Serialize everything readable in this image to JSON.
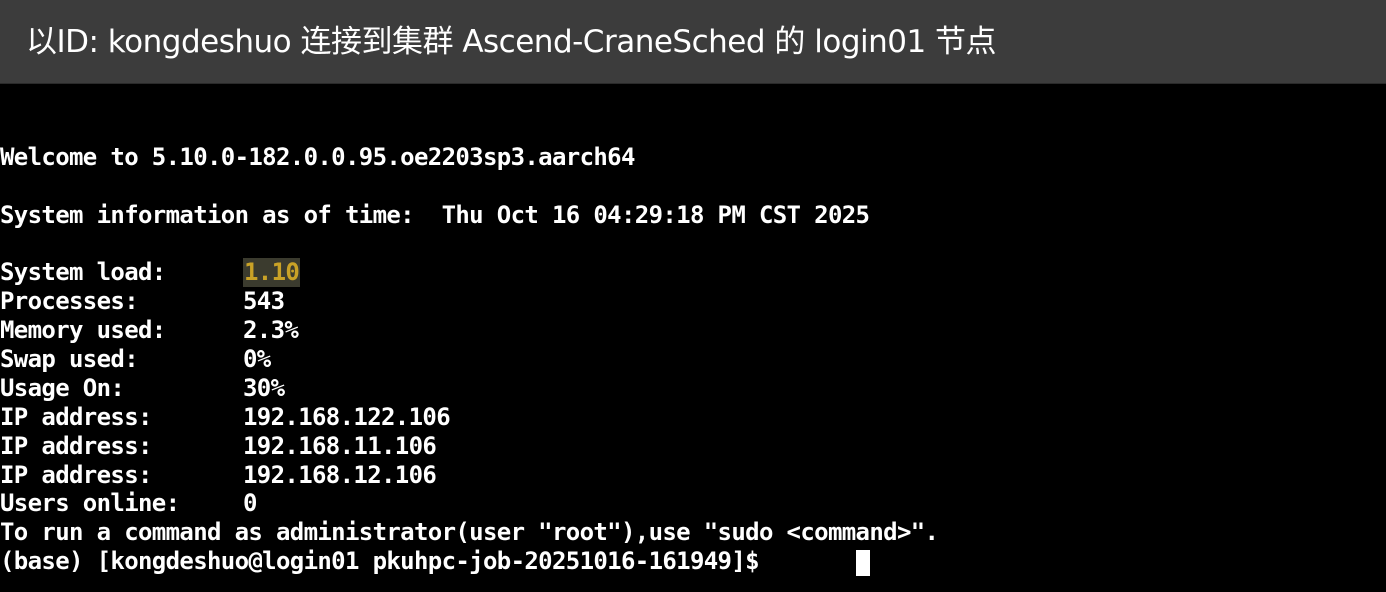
{
  "window": {
    "title": "以ID: kongdeshuo 连接到集群 Ascend-CraneSched 的 login01 节点"
  },
  "terminal": {
    "welcome": "Welcome to 5.10.0-182.0.0.95.oe2203sp3.aarch64",
    "sysinfo": "System information as of time:  Thu Oct 16 04:29:18 PM CST 2025",
    "stats": [
      {
        "label": "System load:",
        "value": "1.10"
      },
      {
        "label": "Processes:",
        "value": "543"
      },
      {
        "label": "Memory used:",
        "value": "2.3%"
      },
      {
        "label": "Swap used:",
        "value": "0%"
      },
      {
        "label": "Usage On:",
        "value": "30%"
      },
      {
        "label": "IP address:",
        "value": "192.168.122.106"
      },
      {
        "label": "IP address:",
        "value": "192.168.11.106"
      },
      {
        "label": "IP address:",
        "value": "192.168.12.106"
      },
      {
        "label": "Users online:",
        "value": "0"
      }
    ],
    "admin_hint": "To run a command as administrator(user \"root\"),use \"sudo <command>\".",
    "prompt": "(base) [kongdeshuo@login01 pkuhpc-job-20251016-161949]$ "
  },
  "colors": {
    "background": "#000000",
    "text": "#ffffff",
    "title_bar": "#3c3c3c",
    "highlight_text": "#c9a227",
    "highlight_bg": "#3b3b2e"
  }
}
